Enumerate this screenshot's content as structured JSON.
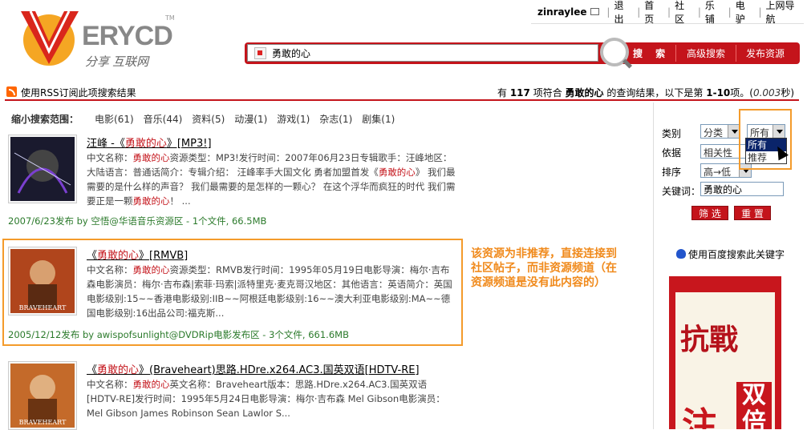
{
  "header": {
    "logo_brand": "ERYCD",
    "logo_tm": "TM",
    "slogan": "分享 互联网",
    "user": "zinraylee",
    "nav": [
      "退出",
      "首页",
      "社区",
      "乐铺",
      "电驴",
      "上网导航"
    ]
  },
  "search": {
    "value": "勇敢的心",
    "buttons": [
      "搜 索",
      "高级搜索",
      "发布资源"
    ]
  },
  "rss": {
    "text": "使用RSS订阅此项搜索结果"
  },
  "result_info": {
    "prefix": "有",
    "count": "117",
    "mid1": "项符合",
    "query": "勇敢的心",
    "mid2": "的查询结果，以下是第",
    "range": "1-10",
    "mid3": "项。(",
    "time": "0.003",
    "suffix": "秒)"
  },
  "narrow": {
    "label": "缩小搜索范围：",
    "categories": [
      "电影(61)",
      "音乐(44)",
      "资料(5)",
      "动漫(1)",
      "游戏(1)",
      "杂志(1)",
      "剧集(1)"
    ]
  },
  "results": [
    {
      "title_pre": "汪峰 -《",
      "title_hl": "勇敢的心",
      "title_post": "》[MP3!]",
      "desc": [
        "中文名称：",
        "勇敢的心",
        "资源类型：MP3!发行时间：2007年06月23日专辑歌手：汪峰地区：大陆语言：普通话简介：专辑介绍：       汪峰率手大国文化 勇者加盟首发《",
        "勇敢的心",
        "》      我们最需要的是什么样的声音？      我们最需要的是怎样的一颗心？      在这个浮华而疯狂的时代      我们需要正是一颗",
        "勇敢的心",
        "！      ..."
      ],
      "meta": "2007/6/23发布 by 空悟@华语音乐资源区 - 1个文件, 66.5MB"
    },
    {
      "title_pre": "《",
      "title_hl": "勇敢的心",
      "title_post": "》[RMVB]",
      "desc": [
        "中文名称：",
        "勇敢的心",
        "资源类型：RMVB发行时间：1995年05月19日电影导演：梅尔·吉布森电影演员：梅尔·吉布森|索菲·玛索|派特里克·麦克哥汉地区：其他语言：英语简介：英国电影级别:15~~香港电影级别:IIB~~阿根廷电影级别:16~~澳大利亚电影级别:MA~~德国电影级别:16出品公司:福克斯..."
      ],
      "meta": "2005/12/12发布 by awispofsunlight@DVDRip电影发布区 - 3个文件, 661.6MB",
      "poster_text": "BRAVEHEART"
    },
    {
      "title_pre": "《",
      "title_hl": "勇敢的心",
      "title_post": "》(Braveheart)思路.HDre.x264.AC3.国英双语[HDTV-RE]",
      "desc": [
        "中文名称：",
        "勇敢的心",
        "英文名称：Braveheart版本：思路.HDre.x264.AC3.国英双语[HDTV-RE]发行时间：1995年5月24日电影导演：梅尔·吉布森 Mel Gibson电影演员：Mel Gibson       James Robinson       Sean Lawlor       S..."
      ],
      "poster_text": "BRAVEHEART"
    }
  ],
  "annotation": "该资源为非推荐，直接连接到社区帖子，而非资源频道（在资源频道是没有此内容的）",
  "sidebar": {
    "category_label": "类别",
    "category_value": "分类",
    "recommend_value": "所有",
    "dropdown_options": [
      "所有",
      "推荐"
    ],
    "sort_basis_label": "依据",
    "sort_basis_value": "相关性",
    "order_label": "排序",
    "order_value": "高→低",
    "keyword_label": "关键词：",
    "keyword_value": "勇敢的心",
    "filter_button": "筛 选",
    "reset_button": "重 置",
    "baidu_text": "使用百度搜索此关键字"
  },
  "ad": {
    "line1": "抗戰",
    "line2": "双倍",
    "line3": "注"
  },
  "colors": {
    "brand_red": "#c4141b",
    "meta_green": "#2b7a2b",
    "annotation_orange": "#f08a1c"
  }
}
